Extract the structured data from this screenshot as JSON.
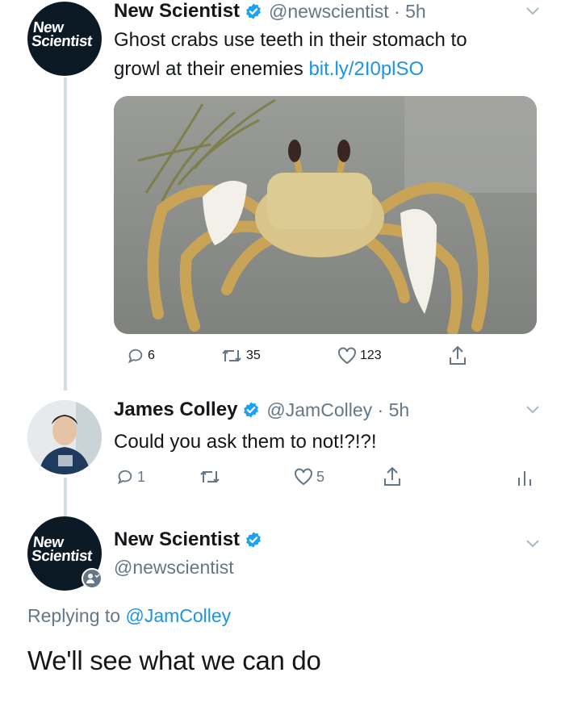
{
  "tweet1": {
    "avatar_text": [
      "New",
      "Scientist"
    ],
    "display_name": "New Scientist",
    "handle_time": "@newscientist · 5h",
    "text_line1": "Ghost crabs use teeth in their stomach to",
    "text_line2": "growl at their enemies ",
    "link": "bit.ly/2I0plSO",
    "replies": "6",
    "retweets": "35",
    "likes": "123"
  },
  "tweet2": {
    "display_name": "James Colley",
    "handle_time": "@JamColley · 5h",
    "text": "Could you ask them to not!?!?!",
    "replies": "1",
    "retweets": "",
    "likes": "5"
  },
  "tweet3": {
    "avatar_text": [
      "New",
      "Scientist"
    ],
    "display_name": "New Scientist",
    "handle": "@newscientist",
    "replying_prefix": "Replying to ",
    "replying_mention": "@JamColley",
    "text": "We'll see what we can do"
  },
  "colors": {
    "verified": "#1da1f2",
    "link": "#1b95e0",
    "secondary_text": "#657786",
    "thread_line": "#d3dde4"
  }
}
